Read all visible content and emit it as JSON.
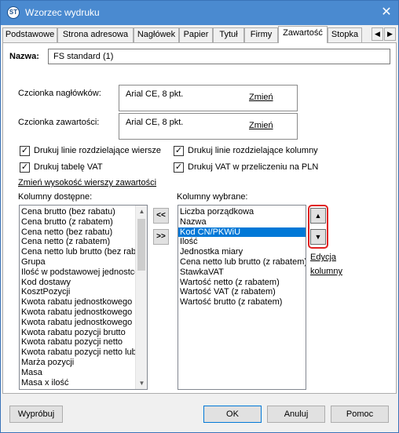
{
  "window": {
    "title": "Wzorzec wydruku",
    "icon": "app-logo-icon"
  },
  "tabs": [
    {
      "label": "Podstawowe"
    },
    {
      "label": "Strona adresowa"
    },
    {
      "label": "Nagłówek"
    },
    {
      "label": "Papier"
    },
    {
      "label": "Tytuł"
    },
    {
      "label": "Firmy"
    },
    {
      "label": "Zawartość"
    },
    {
      "label": "Stopka"
    }
  ],
  "active_tab": "Zawartość",
  "name": {
    "label": "Nazwa:",
    "value": "FS standard (1)"
  },
  "header_font": {
    "label": "Czcionka nagłówków:",
    "value": "Arial CE, 8 pkt.",
    "change_link": "Zmień"
  },
  "content_font": {
    "label": "Czcionka zawartości:",
    "value": "Arial CE, 8 pkt.",
    "change_link": "Zmień"
  },
  "checkboxes": {
    "row_lines": {
      "label": "Drukuj linie rozdzielające wiersze",
      "checked": "✓"
    },
    "col_lines": {
      "label": "Drukuj linie rozdzielające kolumny",
      "checked": "✓"
    },
    "vat_table": {
      "label": "Drukuj tabelę VAT",
      "checked": "✓"
    },
    "vat_pln": {
      "label": "Drukuj VAT w przeliczeniu na PLN",
      "checked": "✓"
    }
  },
  "row_height_link": "Zmień wysokość wierszy zawartości",
  "available_columns": {
    "label": "Kolumny dostępne:",
    "items": [
      "Cena brutto (bez rabatu)",
      "Cena brutto (z rabatem)",
      "Cena netto (bez rabatu)",
      "Cena netto (z rabatem)",
      "Cena netto lub brutto (bez rabatu)",
      "Grupa",
      "Ilość w podstawowej jednostce",
      "Kod dostawy",
      "KosztPozycji",
      "Kwota rabatu jednostkowego",
      "Kwota rabatu jednostkowego",
      "Kwota rabatu jednostkowego",
      "Kwota rabatu pozycji brutto",
      "Kwota rabatu pozycji netto",
      "Kwota rabatu pozycji netto lub",
      "Marża pozycji",
      "Masa",
      "Masa x ilość"
    ]
  },
  "move_buttons": {
    "remove": "<<",
    "add": ">>"
  },
  "selected_columns": {
    "label": "Kolumny wybrane:",
    "items": [
      "Liczba porządkowa",
      "Nazwa",
      "Kod CN/PKWiU",
      "Ilość",
      "Jednostka miary",
      "Cena netto lub brutto (z rabatem)",
      "StawkaVAT",
      "Wartość netto (z rabatem)",
      "Wartość VAT (z rabatem)",
      "Wartość brutto (z rabatem)"
    ],
    "selected_item": "Kod CN/PKWiU"
  },
  "order_buttons": {
    "up_icon": "arrow-up-icon",
    "down_icon": "arrow-down-icon"
  },
  "edit_column_link": {
    "line1": "Edycja",
    "line2": "kolumny"
  },
  "footer": {
    "try_button": "Wypróbuj",
    "ok_button": "OK",
    "cancel_button": "Anuluj",
    "help_button": "Pomoc"
  },
  "colors": {
    "titlebar": "#4a8ad0",
    "selection": "#0078d7",
    "highlight": "#e02020"
  }
}
